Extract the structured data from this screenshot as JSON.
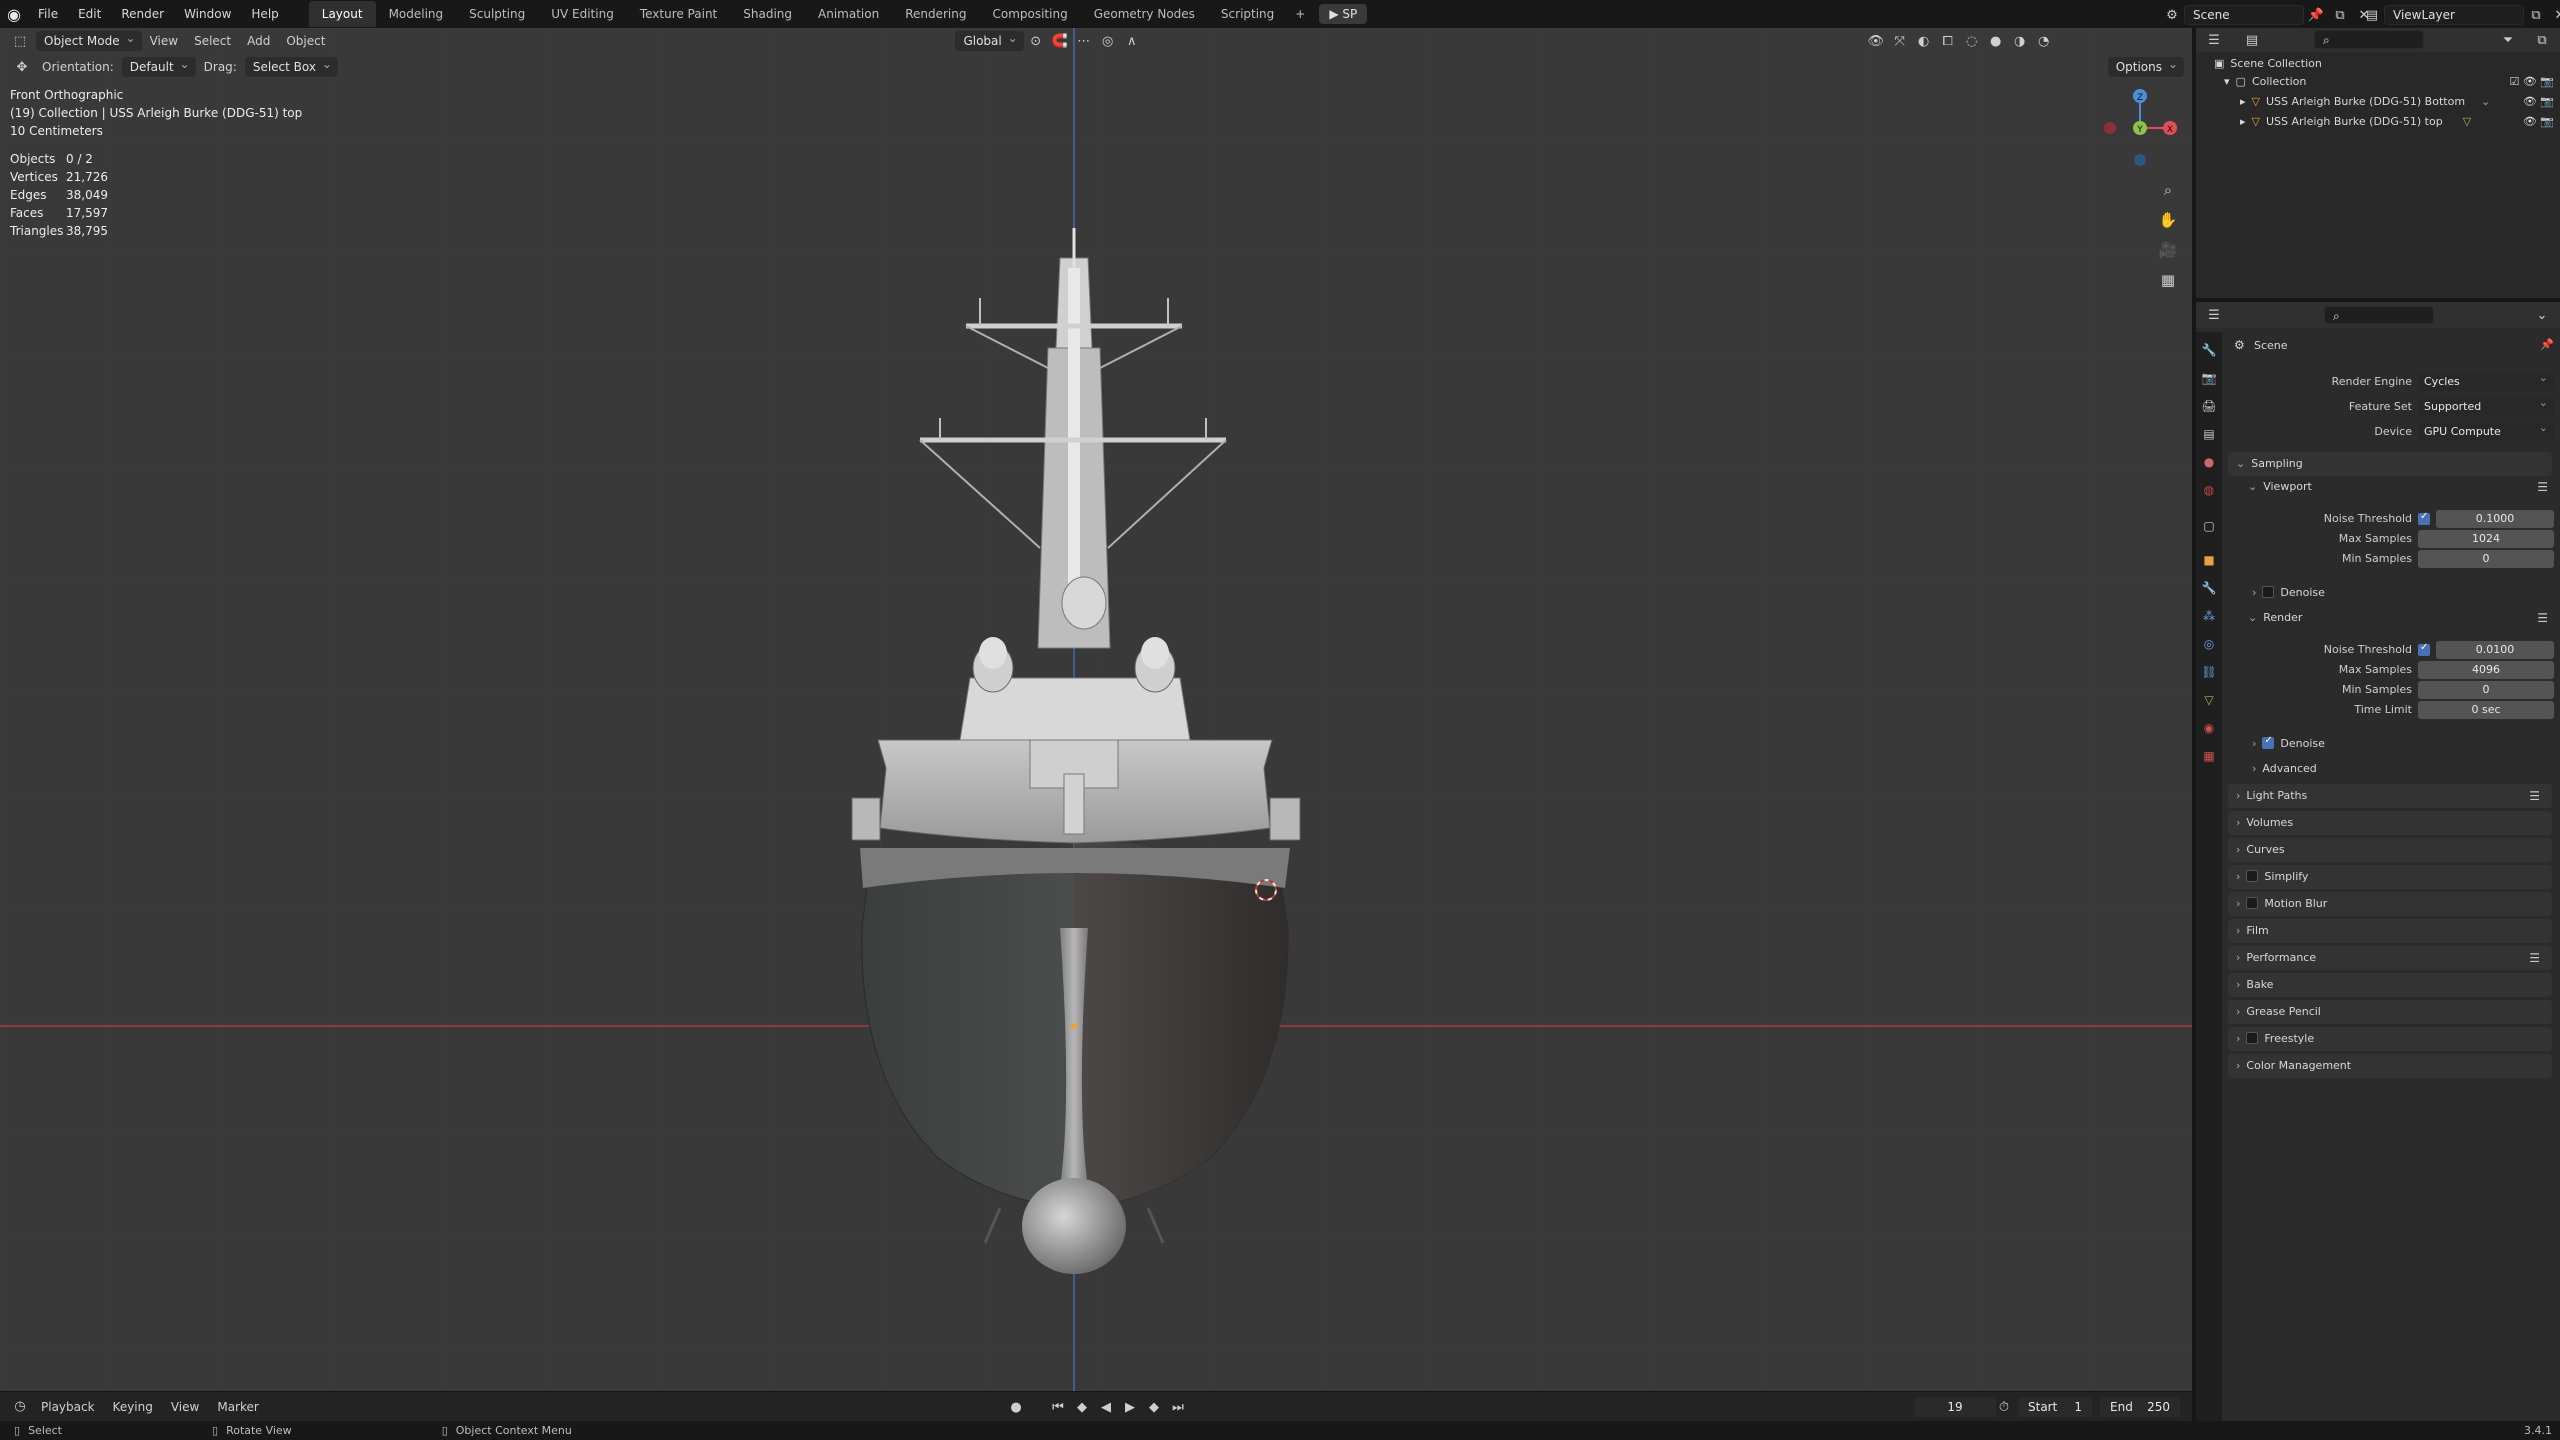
{
  "menu": [
    "File",
    "Edit",
    "Render",
    "Window",
    "Help"
  ],
  "workspaces": [
    "Layout",
    "Modeling",
    "Sculpting",
    "UV Editing",
    "Texture Paint",
    "Shading",
    "Animation",
    "Rendering",
    "Compositing",
    "Geometry Nodes",
    "Scripting"
  ],
  "workspace_add": "+",
  "sp_label": "SP",
  "scene_name": "Scene",
  "view_layer": "ViewLayer",
  "viewport_header": {
    "mode": "Object Mode",
    "menus": [
      "View",
      "Select",
      "Add",
      "Object"
    ],
    "transform": "Global",
    "orientation_label": "Orientation:",
    "orientation_value": "Default",
    "drag_label": "Drag:",
    "drag_value": "Select Box",
    "options": "Options"
  },
  "viewport_info": {
    "view_name": "Front Orthographic",
    "collection_line": "(19) Collection | USS Arleigh Burke (DDG-51) top",
    "scale": "10 Centimeters"
  },
  "stats": [
    {
      "label": "Objects",
      "value": "0 / 2"
    },
    {
      "label": "Vertices",
      "value": "21,726"
    },
    {
      "label": "Edges",
      "value": "38,049"
    },
    {
      "label": "Faces",
      "value": "17,597"
    },
    {
      "label": "Triangles",
      "value": "38,795"
    }
  ],
  "gizmo_axes": {
    "x": "X",
    "y": "Y",
    "z": "Z"
  },
  "timeline": {
    "menus": [
      "Playback",
      "Keying",
      "View",
      "Marker"
    ],
    "current_frame": "19",
    "start_label": "Start",
    "start": "1",
    "end_label": "End",
    "end": "250"
  },
  "statusbar": {
    "select": "Select",
    "rotate": "Rotate View",
    "context": "Object Context Menu",
    "version": "3.4.1"
  },
  "outliner": {
    "root": "Scene Collection",
    "collection": "Collection",
    "objects": [
      "USS Arleigh Burke (DDG-51) Bottom",
      "USS Arleigh Burke (DDG-51) top"
    ]
  },
  "properties": {
    "context": "Scene",
    "render_engine_label": "Render Engine",
    "render_engine": "Cycles",
    "feature_set_label": "Feature Set",
    "feature_set": "Supported",
    "device_label": "Device",
    "device": "GPU Compute",
    "sampling": "Sampling",
    "viewport": "Viewport",
    "vp_noise_label": "Noise Threshold",
    "vp_noise": "0.1000",
    "vp_max_label": "Max Samples",
    "vp_max": "1024",
    "vp_min_label": "Min Samples",
    "vp_min": "0",
    "denoise": "Denoise",
    "render": "Render",
    "r_noise_label": "Noise Threshold",
    "r_noise": "0.0100",
    "r_max_label": "Max Samples",
    "r_max": "4096",
    "r_min_label": "Min Samples",
    "r_min": "0",
    "r_time_label": "Time Limit",
    "r_time": "0 sec",
    "r_denoise": "Denoise",
    "advanced": "Advanced",
    "panels": [
      "Light Paths",
      "Volumes",
      "Curves",
      "Simplify",
      "Motion Blur",
      "Film",
      "Performance",
      "Bake",
      "Grease Pencil",
      "Freestyle",
      "Color Management"
    ]
  },
  "colors": {
    "accent": "#4772b3",
    "x_axis": "#e24d5c",
    "y_axis": "#8bc34a",
    "z_axis": "#4a90d9",
    "viewport_bg": "#393939"
  }
}
